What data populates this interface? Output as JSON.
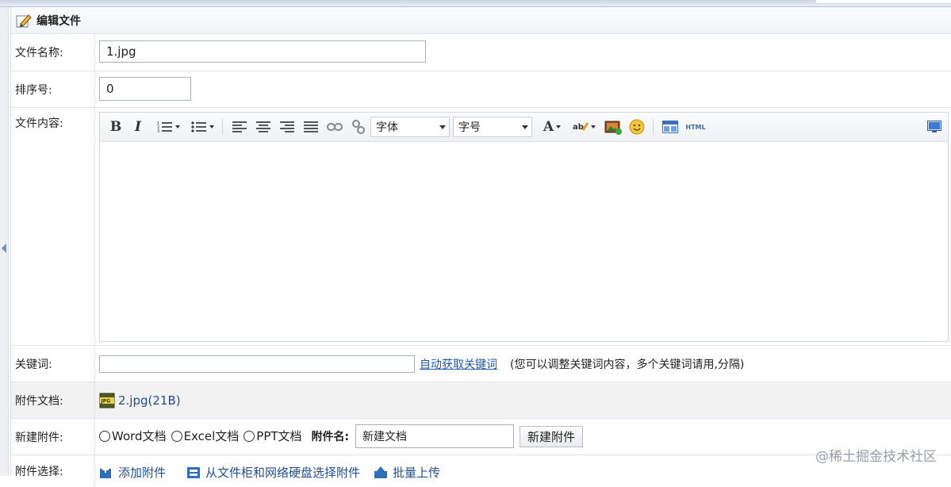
{
  "panel": {
    "title": "编辑文件"
  },
  "fields": {
    "file_name": {
      "label": "文件名称:",
      "value": "1.jpg"
    },
    "sort_no": {
      "label": "排序号:",
      "value": "0"
    },
    "content": {
      "label": "文件内容:"
    },
    "keywords": {
      "label": "关键词:",
      "value": "",
      "auto_link": "自动获取关键词",
      "hint": "(您可以调整关键词内容，多个关键词请用,分隔)"
    },
    "attachment_doc": {
      "label": "附件文档:",
      "file_link": "2.jpg",
      "file_size": "(21B)"
    },
    "new_attachment": {
      "label": "新建附件:",
      "options": [
        "Word文档",
        "Excel文档",
        "PPT文档"
      ],
      "name_label": "附件名:",
      "name_value": "新建文档",
      "button_label": "新建附件"
    },
    "attachment_select": {
      "label": "附件选择:",
      "actions": [
        "添加附件",
        "从文件柜和网络硬盘选择附件",
        "批量上传"
      ]
    }
  },
  "editor": {
    "bold": "B",
    "italic": "I",
    "font_family": "字体",
    "font_size": "字号",
    "font_color": "A",
    "html": "HTML",
    "icons": [
      "bold-icon",
      "italic-icon",
      "ordered-list-icon",
      "unordered-list-icon",
      "align-left-icon",
      "align-center-icon",
      "align-right-icon",
      "justify-icon",
      "link-icon",
      "unlink-icon",
      "font-color-icon",
      "highlight-icon",
      "image-icon",
      "emoticon-icon",
      "table-icon",
      "html-icon",
      "fullscreen-icon"
    ]
  },
  "watermark": "@稀土掘金技术社区"
}
